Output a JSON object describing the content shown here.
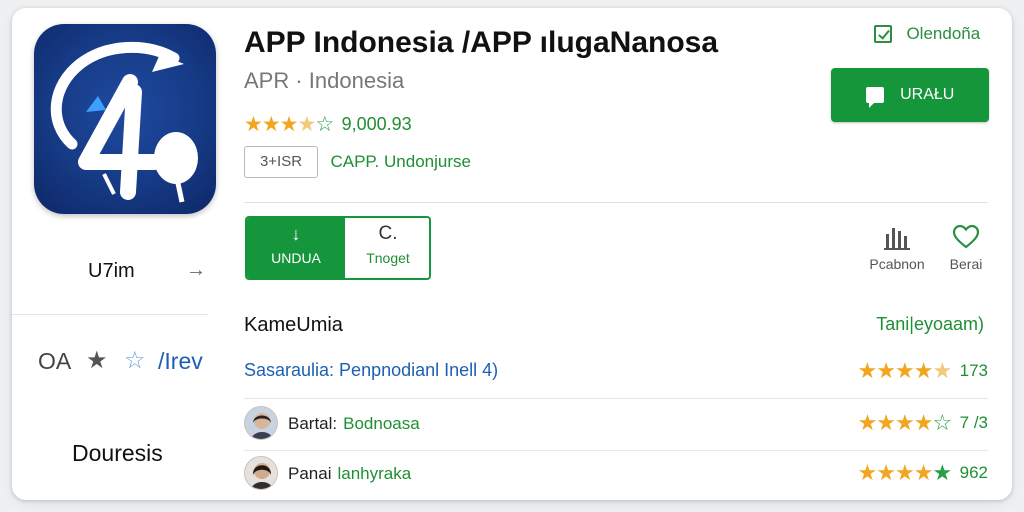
{
  "header": {
    "title": "APP Indonesia /APP ılugaNanosa",
    "subtitle": "APR · Indonesia",
    "rating_value": "9,000.93",
    "age_badge": "3+ISR",
    "developer": "CAPP. Undonjurse",
    "wishlist_label": "Olendoña",
    "install_label": "URAŁU"
  },
  "left": {
    "size_label": "U7im",
    "qa_label": "OA",
    "qa_link": "/Irev",
    "docs_label": "Douresis"
  },
  "actions": {
    "download_label": "UNDUA",
    "target_label": "Tnoget",
    "chart_label": "Pcabnon",
    "favorite_label": "Berai"
  },
  "reviews": {
    "heading": "KameUmia",
    "filter": "Tani|eyoaam)",
    "summary": {
      "text": "Sasaraulia: Penpnodianl Inell 4)",
      "stars": 4,
      "score": "173"
    },
    "items": [
      {
        "name": "Bartal:",
        "text": "Bodnoasa",
        "stars": 3.5,
        "score": "7 /3"
      },
      {
        "name": "Panai",
        "text": "lanhyraka",
        "stars": 4.5,
        "score": "962"
      }
    ]
  },
  "colors": {
    "accent_green": "#15963b",
    "link_blue": "#1e5fb4",
    "star": "#f2a51f",
    "icon_bg": "#163a85"
  },
  "icons": {
    "app": "app-logo-4-icon",
    "wishlist": "bookmark-check-icon",
    "install": "chat-bubble-icon",
    "download": "download-arrow-icon",
    "target": "refresh-icon",
    "chart": "bar-chart-icon",
    "favorite": "heart-icon",
    "arrow": "chevron-right-icon"
  }
}
